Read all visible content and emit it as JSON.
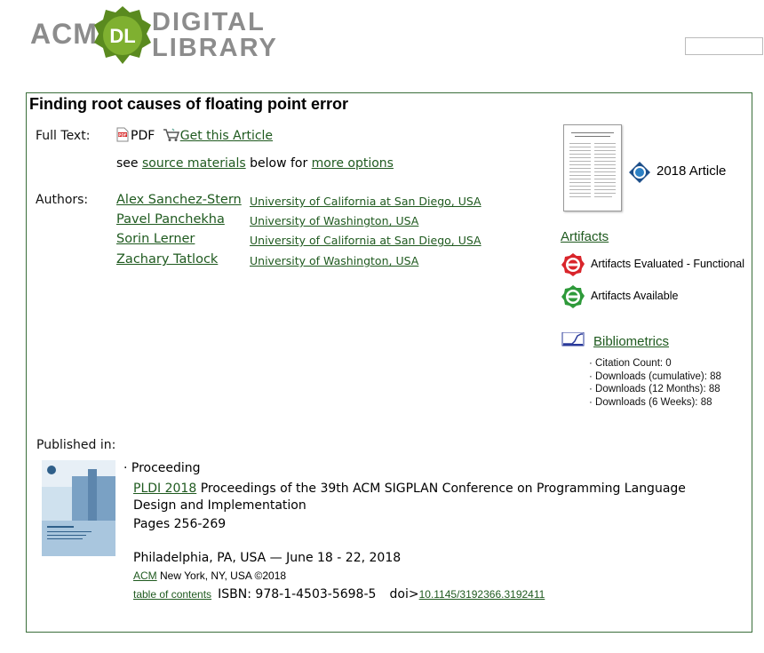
{
  "header": {
    "logo_acm": "ACM",
    "logo_badge": "DL",
    "logo_line1": "DIGITAL",
    "logo_line2": "LIBRARY",
    "search_value": ""
  },
  "article": {
    "title": "Finding root causes of floating point error",
    "full_text_label": "Full Text:",
    "pdf_label": "PDF",
    "get_article_label": "Get this Article",
    "see_prefix": "see",
    "source_materials_label": "source materials",
    "below_for": "below for",
    "more_options_label": "more options",
    "authors_label": "Authors:",
    "authors": [
      {
        "name": "Alex Sanchez-Stern",
        "affiliation": "University of California at San Diego, USA"
      },
      {
        "name": "Pavel Panchekha",
        "affiliation": "University of Washington, USA"
      },
      {
        "name": "Sorin Lerner",
        "affiliation": "University of California at San Diego, USA"
      },
      {
        "name": "Zachary Tatlock",
        "affiliation": "University of Washington, USA"
      }
    ]
  },
  "sidebar": {
    "article_year": "2018 Article",
    "artifacts_label": "Artifacts",
    "artifacts_evaluated": "Artifacts Evaluated - Functional",
    "artifacts_available": "Artifacts Available",
    "bibliometrics_label": "Bibliometrics",
    "stats": [
      "· Citation Count: 0",
      "· Downloads (cumulative): 88",
      "· Downloads (12 Months): 88",
      "· Downloads (6 Weeks): 88"
    ]
  },
  "published": {
    "label": "Published in:",
    "type": "· Proceeding",
    "conf_link": "PLDI 2018",
    "conf_title_line1": "Proceedings of the 39th ACM SIGPLAN Conference on Programming Language",
    "conf_title_line2": "Design and Implementation",
    "pages": "Pages 256-269",
    "location": "Philadelphia, PA, USA — June 18 - 22, 2018",
    "publisher_link": "ACM",
    "publisher_rest": "New York, NY, USA ©2018",
    "toc_label": "table of contents",
    "isbn": "ISBN: 978-1-4503-5698-5",
    "doi_label": "doi>",
    "doi_link": "10.1145/3192366.3192411"
  },
  "colors": {
    "link": "#1f5a1f",
    "border": "#3a6e3a",
    "logo_green": "#5a8a1f",
    "logo_gray": "#8c8c8c",
    "badge_red": "#d9252b",
    "badge_green": "#2e9a3a"
  },
  "icons": [
    "pdf-icon",
    "shopping-cart-icon",
    "acm-award-icon",
    "artifacts-evaluated-badge-icon",
    "artifacts-available-badge-icon",
    "bibliometrics-chart-icon"
  ]
}
